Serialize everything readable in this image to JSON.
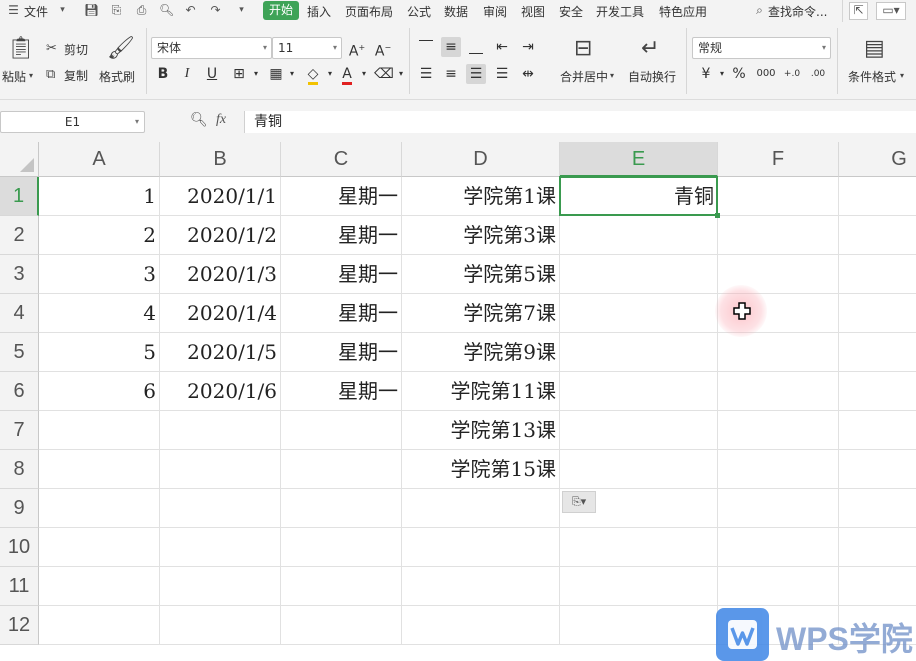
{
  "menubar": {
    "file": "文件",
    "tabs": [
      "开始",
      "插入",
      "页面布局",
      "公式",
      "数据",
      "审阅",
      "视图",
      "安全",
      "开发工具",
      "特色应用"
    ],
    "search": "查找命令..."
  },
  "ribbon": {
    "paste": "粘贴",
    "cut": "剪切",
    "copy": "复制",
    "format_painter": "格式刷",
    "font_name": "宋体",
    "font_size": "11",
    "merge_center": "合并居中",
    "wrap_text": "自动换行",
    "number_format": "常规",
    "conditional_format": "条件格式"
  },
  "formula_bar": {
    "cell_ref": "E1",
    "fx": "fx",
    "content": "青铜"
  },
  "sheet": {
    "columns": [
      "A",
      "B",
      "C",
      "D",
      "E",
      "F",
      "G"
    ],
    "rows": [
      "1",
      "2",
      "3",
      "4",
      "5",
      "6",
      "7",
      "8",
      "9",
      "10",
      "11",
      "12"
    ],
    "cells": {
      "A": [
        "1",
        "2",
        "3",
        "4",
        "5",
        "6"
      ],
      "B": [
        "2020/1/1",
        "2020/1/2",
        "2020/1/3",
        "2020/1/4",
        "2020/1/5",
        "2020/1/6"
      ],
      "C": [
        "星期一",
        "星期一",
        "星期一",
        "星期一",
        "星期一",
        "星期一"
      ],
      "D": [
        "学院第1课",
        "学院第3课",
        "学院第5课",
        "学院第7课",
        "学院第9课",
        "学院第11课",
        "学院第13课",
        "学院第15课"
      ],
      "E": [
        "青铜"
      ]
    },
    "selected_cell": "E1"
  },
  "watermark": {
    "text": "WPS学院"
  },
  "colors": {
    "accent": "#3ea357",
    "selection": "#3a9a4f",
    "header_bg": "#f3f3f3"
  }
}
